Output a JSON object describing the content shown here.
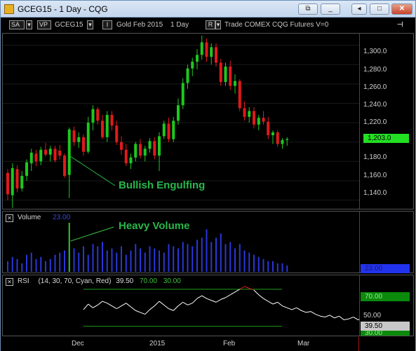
{
  "window": {
    "title": "GCEG15 - 1 Day - CQG",
    "buttons": {
      "restore_down": "⧉",
      "minimize": "_",
      "back": "◂",
      "maximize": "□",
      "close": "✕"
    }
  },
  "toolbar": {
    "sa_label": "SA",
    "vp_label": "VP",
    "symbol": "GCEG15",
    "interval_button": "I",
    "description": "Gold Feb 2015",
    "timeframe": "1 Day",
    "r_button": "R",
    "info": "Trade  COMEX  CQG  Futures  V=0",
    "pin_icon": "⊣"
  },
  "price_panel": {
    "y_ticks": [
      "1,300.0",
      "1,280.0",
      "1,260.0",
      "1,240.0",
      "1,220.0",
      "1,180.0",
      "1,160.0",
      "1,140.0"
    ],
    "last_price": "1,203.0",
    "annotation": "Bullish Engulfing",
    "colors": {
      "up": "#1ec81e",
      "down": "#e11a1a",
      "annotation": "#27b84a",
      "last_tag": "#22e022"
    }
  },
  "volume_panel": {
    "title": "Volume",
    "value": "23.00",
    "annotation": "Heavy Volume",
    "axis_value": "23.00",
    "colors": {
      "bars": "#2a37d8",
      "highlight": "#3ac03a"
    }
  },
  "rsi_panel": {
    "title": "RSI",
    "params": "(14, 30, 70, Cyan, Red)",
    "value": "39.50",
    "upper": "70.00",
    "lower": "30.00",
    "mid_label": "50.00",
    "upper_tag": "70.00",
    "current_tag": "39.50",
    "lower_tag": "30.00",
    "colors": {
      "line": "#ffffff",
      "overbought": "#e02020",
      "levels": "#1ea01e",
      "upper_tag_bg": "#0b8a0b",
      "current_tag_bg": "#c8c8c8"
    }
  },
  "x_axis": {
    "labels": [
      "Dec",
      "2015",
      "Feb",
      "Mar"
    ]
  },
  "chart_data": {
    "type": "candlestick",
    "instrument": "GCEG15",
    "interval": "1 Day",
    "price_axis": {
      "ylim": [
        1131,
        1312
      ]
    },
    "candles": [
      {
        "o": 1168,
        "h": 1172,
        "l": 1140,
        "c": 1146
      },
      {
        "o": 1145,
        "h": 1178,
        "l": 1132,
        "c": 1173
      },
      {
        "o": 1172,
        "h": 1176,
        "l": 1148,
        "c": 1152
      },
      {
        "o": 1152,
        "h": 1170,
        "l": 1149,
        "c": 1165
      },
      {
        "o": 1165,
        "h": 1182,
        "l": 1160,
        "c": 1179
      },
      {
        "o": 1178,
        "h": 1193,
        "l": 1170,
        "c": 1189
      },
      {
        "o": 1188,
        "h": 1192,
        "l": 1175,
        "c": 1180
      },
      {
        "o": 1180,
        "h": 1195,
        "l": 1176,
        "c": 1192
      },
      {
        "o": 1192,
        "h": 1199,
        "l": 1185,
        "c": 1187
      },
      {
        "o": 1187,
        "h": 1196,
        "l": 1180,
        "c": 1193
      },
      {
        "o": 1193,
        "h": 1196,
        "l": 1179,
        "c": 1181
      },
      {
        "o": 1191,
        "h": 1197,
        "l": 1182,
        "c": 1186
      },
      {
        "o": 1186,
        "h": 1188,
        "l": 1163,
        "c": 1165
      },
      {
        "o": 1166,
        "h": 1215,
        "l": 1142,
        "c": 1213
      },
      {
        "o": 1212,
        "h": 1216,
        "l": 1196,
        "c": 1200
      },
      {
        "o": 1200,
        "h": 1210,
        "l": 1194,
        "c": 1205
      },
      {
        "o": 1205,
        "h": 1208,
        "l": 1186,
        "c": 1190
      },
      {
        "o": 1190,
        "h": 1226,
        "l": 1188,
        "c": 1220
      },
      {
        "o": 1220,
        "h": 1238,
        "l": 1212,
        "c": 1234
      },
      {
        "o": 1234,
        "h": 1236,
        "l": 1218,
        "c": 1222
      },
      {
        "o": 1222,
        "h": 1228,
        "l": 1203,
        "c": 1205
      },
      {
        "o": 1205,
        "h": 1232,
        "l": 1200,
        "c": 1228
      },
      {
        "o": 1228,
        "h": 1232,
        "l": 1212,
        "c": 1217
      },
      {
        "o": 1217,
        "h": 1222,
        "l": 1197,
        "c": 1200
      },
      {
        "o": 1200,
        "h": 1206,
        "l": 1187,
        "c": 1192
      },
      {
        "o": 1192,
        "h": 1198,
        "l": 1175,
        "c": 1178
      },
      {
        "o": 1178,
        "h": 1188,
        "l": 1172,
        "c": 1184
      },
      {
        "o": 1184,
        "h": 1200,
        "l": 1180,
        "c": 1198
      },
      {
        "o": 1198,
        "h": 1203,
        "l": 1183,
        "c": 1186
      },
      {
        "o": 1186,
        "h": 1196,
        "l": 1180,
        "c": 1193
      },
      {
        "o": 1193,
        "h": 1204,
        "l": 1189,
        "c": 1201
      },
      {
        "o": 1201,
        "h": 1205,
        "l": 1182,
        "c": 1186
      },
      {
        "o": 1186,
        "h": 1210,
        "l": 1170,
        "c": 1206
      },
      {
        "o": 1206,
        "h": 1222,
        "l": 1203,
        "c": 1219
      },
      {
        "o": 1219,
        "h": 1225,
        "l": 1200,
        "c": 1203
      },
      {
        "o": 1203,
        "h": 1226,
        "l": 1200,
        "c": 1222
      },
      {
        "o": 1222,
        "h": 1245,
        "l": 1218,
        "c": 1238
      },
      {
        "o": 1238,
        "h": 1266,
        "l": 1234,
        "c": 1261
      },
      {
        "o": 1261,
        "h": 1280,
        "l": 1255,
        "c": 1276
      },
      {
        "o": 1276,
        "h": 1287,
        "l": 1268,
        "c": 1283
      },
      {
        "o": 1283,
        "h": 1296,
        "l": 1275,
        "c": 1290
      },
      {
        "o": 1290,
        "h": 1310,
        "l": 1285,
        "c": 1303
      },
      {
        "o": 1303,
        "h": 1307,
        "l": 1283,
        "c": 1288
      },
      {
        "o": 1288,
        "h": 1302,
        "l": 1280,
        "c": 1298
      },
      {
        "o": 1298,
        "h": 1302,
        "l": 1278,
        "c": 1282
      },
      {
        "o": 1282,
        "h": 1286,
        "l": 1258,
        "c": 1262
      },
      {
        "o": 1262,
        "h": 1282,
        "l": 1258,
        "c": 1278
      },
      {
        "o": 1278,
        "h": 1284,
        "l": 1254,
        "c": 1258
      },
      {
        "o": 1258,
        "h": 1270,
        "l": 1250,
        "c": 1263
      },
      {
        "o": 1263,
        "h": 1265,
        "l": 1232,
        "c": 1235
      },
      {
        "o": 1235,
        "h": 1242,
        "l": 1222,
        "c": 1226
      },
      {
        "o": 1226,
        "h": 1236,
        "l": 1220,
        "c": 1232
      },
      {
        "o": 1232,
        "h": 1236,
        "l": 1214,
        "c": 1218
      },
      {
        "o": 1218,
        "h": 1228,
        "l": 1212,
        "c": 1225
      },
      {
        "o": 1225,
        "h": 1232,
        "l": 1218,
        "c": 1221
      },
      {
        "o": 1221,
        "h": 1226,
        "l": 1203,
        "c": 1207
      },
      {
        "o": 1207,
        "h": 1212,
        "l": 1198,
        "c": 1210
      },
      {
        "o": 1210,
        "h": 1212,
        "l": 1195,
        "c": 1198
      },
      {
        "o": 1198,
        "h": 1204,
        "l": 1193,
        "c": 1202
      },
      {
        "o": 1202,
        "h": 1205,
        "l": 1196,
        "c": 1203
      }
    ],
    "volume": [
      5,
      7,
      6,
      4,
      8,
      9,
      6,
      7,
      5,
      6,
      8,
      9,
      10,
      23,
      11,
      9,
      12,
      8,
      13,
      12,
      14,
      10,
      11,
      9,
      12,
      8,
      10,
      13,
      11,
      9,
      12,
      11,
      10,
      9,
      13,
      12,
      11,
      14,
      13,
      12,
      15,
      16,
      20,
      14,
      16,
      18,
      13,
      14,
      11,
      13,
      10,
      9,
      8,
      7,
      6,
      5,
      5,
      4,
      4,
      3
    ],
    "rsi": [
      48,
      54,
      50,
      53,
      57,
      55,
      52,
      49,
      52,
      55,
      51,
      47,
      45,
      43,
      48,
      52,
      57,
      53,
      49,
      47,
      52,
      56,
      53,
      55,
      60,
      63,
      60,
      58,
      56,
      59,
      61,
      64,
      67,
      70,
      73,
      71,
      69,
      64,
      60,
      57,
      54,
      56,
      52,
      50,
      48,
      50,
      47,
      45,
      46,
      43,
      41,
      40,
      42,
      39,
      41,
      37,
      38,
      40,
      37,
      39.5
    ],
    "rsi_levels": {
      "upper": 70,
      "lower": 30,
      "mid": 50
    },
    "x_labels": [
      "Dec",
      "2015",
      "Feb",
      "Mar"
    ]
  }
}
